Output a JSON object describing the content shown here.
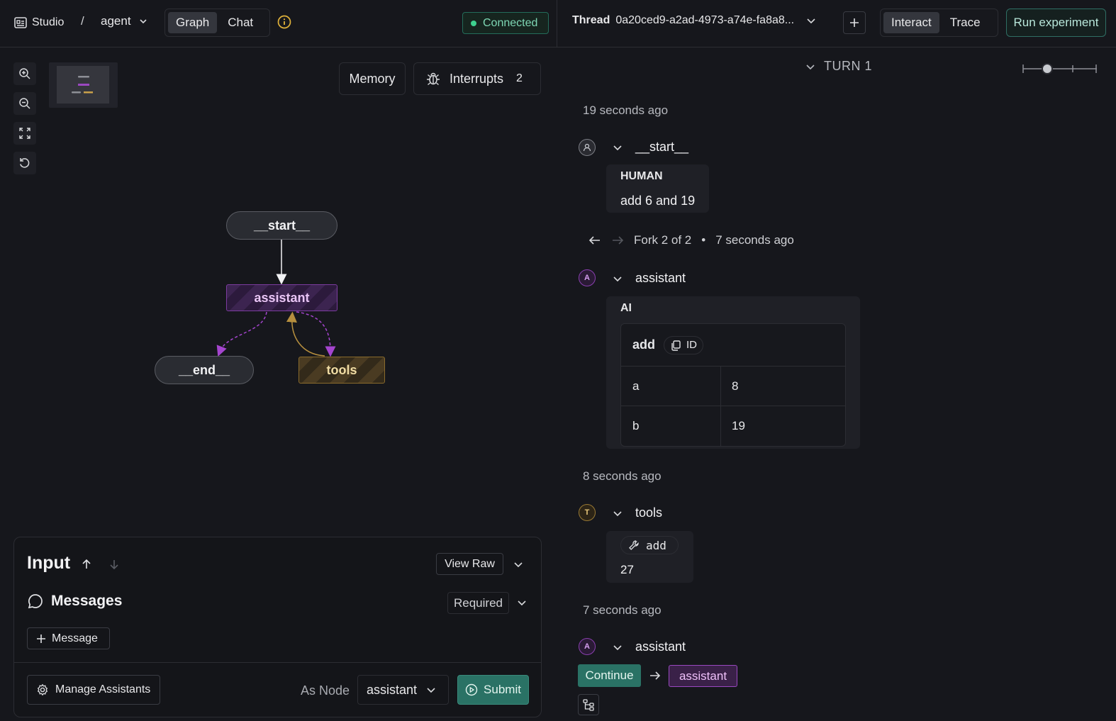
{
  "header": {
    "studio_label": "Studio",
    "breadcrumb_sep": "/",
    "graph_name": "agent",
    "view_tabs": [
      "Graph",
      "Chat"
    ],
    "active_view": "Graph",
    "status": "Connected",
    "thread_label": "Thread",
    "thread_id": "0a20ced9-a2ad-4973-a74e-fa8a8...",
    "mode_tabs": [
      "Interact",
      "Trace"
    ],
    "active_mode": "Interact",
    "run_experiment": "Run experiment"
  },
  "graph": {
    "memory_label": "Memory",
    "interrupts_label": "Interrupts",
    "interrupts_count": "2",
    "nodes": {
      "start": "__start__",
      "assistant": "assistant",
      "end": "__end__",
      "tools": "tools"
    }
  },
  "input": {
    "title": "Input",
    "view_raw": "View Raw",
    "messages_label": "Messages",
    "required_label": "Required",
    "add_message": "Message",
    "manage_assistants": "Manage Assistants",
    "as_node_label": "As Node",
    "as_node_value": "assistant",
    "submit": "Submit"
  },
  "thread_view": {
    "turn_label": "TURN 1",
    "steps": {
      "start_time": "19 seconds ago",
      "start_node": "__start__",
      "human_role": "HUMAN",
      "human_message": "add 6 and 19",
      "fork_label": "Fork 2 of 2",
      "fork_bullet": "•",
      "fork_time": "7 seconds ago",
      "assistant_node": "assistant",
      "assistant_avatar": "A",
      "ai_role": "AI",
      "tool_call_name": "add",
      "id_label": "ID",
      "args": [
        {
          "key": "a",
          "value": "8"
        },
        {
          "key": "b",
          "value": "19"
        }
      ],
      "tools_time": "8 seconds ago",
      "tools_node": "tools",
      "tools_avatar": "T",
      "tool_result_name": "add",
      "tool_result": "27",
      "assistant2_time": "7 seconds ago",
      "assistant2_node": "assistant",
      "continue_label": "Continue",
      "next_node": "assistant"
    }
  },
  "colors": {
    "accent_teal": "#2a7265",
    "assistant_purple": "#9a48c0",
    "tools_gold": "#9a7a34",
    "status_green": "#3ed18f"
  }
}
